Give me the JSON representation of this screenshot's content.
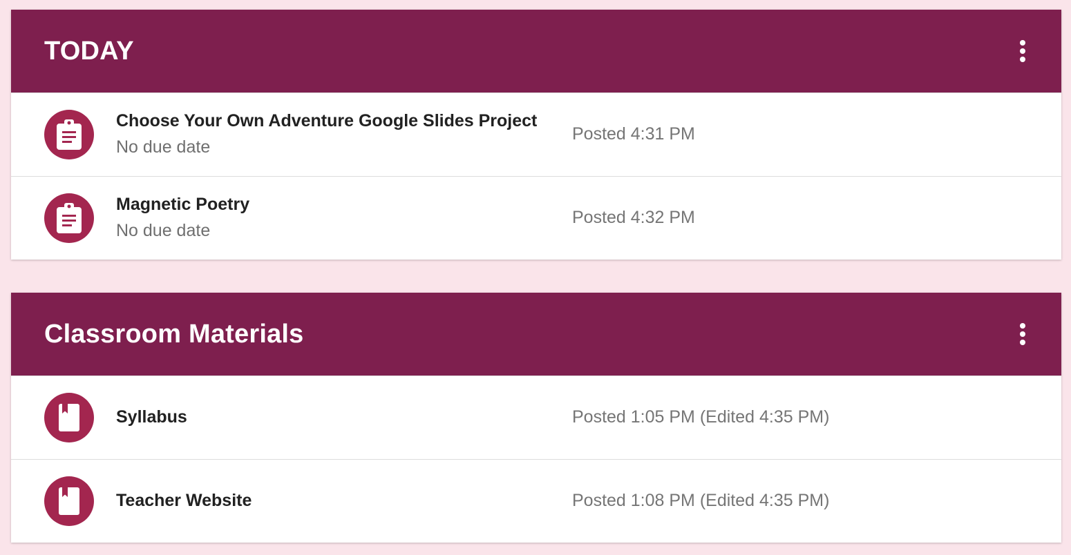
{
  "colors": {
    "page_background": "#fae4ea",
    "header_background": "#7e1f4e",
    "icon_background": "#a3264f"
  },
  "sections": [
    {
      "title": "TODAY",
      "menu_icon": "more-vert-icon",
      "items": [
        {
          "icon": "assignment-icon",
          "title": "Choose Your Own Adventure Google Slides Project",
          "subtitle": "No due date",
          "posted": "Posted 4:31 PM"
        },
        {
          "icon": "assignment-icon",
          "title": "Magnetic Poetry",
          "subtitle": "No due date",
          "posted": "Posted 4:32 PM"
        }
      ]
    },
    {
      "title": "Classroom Materials",
      "menu_icon": "more-vert-icon",
      "items": [
        {
          "icon": "material-book-icon",
          "title": "Syllabus",
          "posted": "Posted 1:05 PM (Edited 4:35 PM)"
        },
        {
          "icon": "material-book-icon",
          "title": "Teacher Website",
          "posted": "Posted 1:08 PM (Edited 4:35 PM)"
        }
      ]
    }
  ]
}
